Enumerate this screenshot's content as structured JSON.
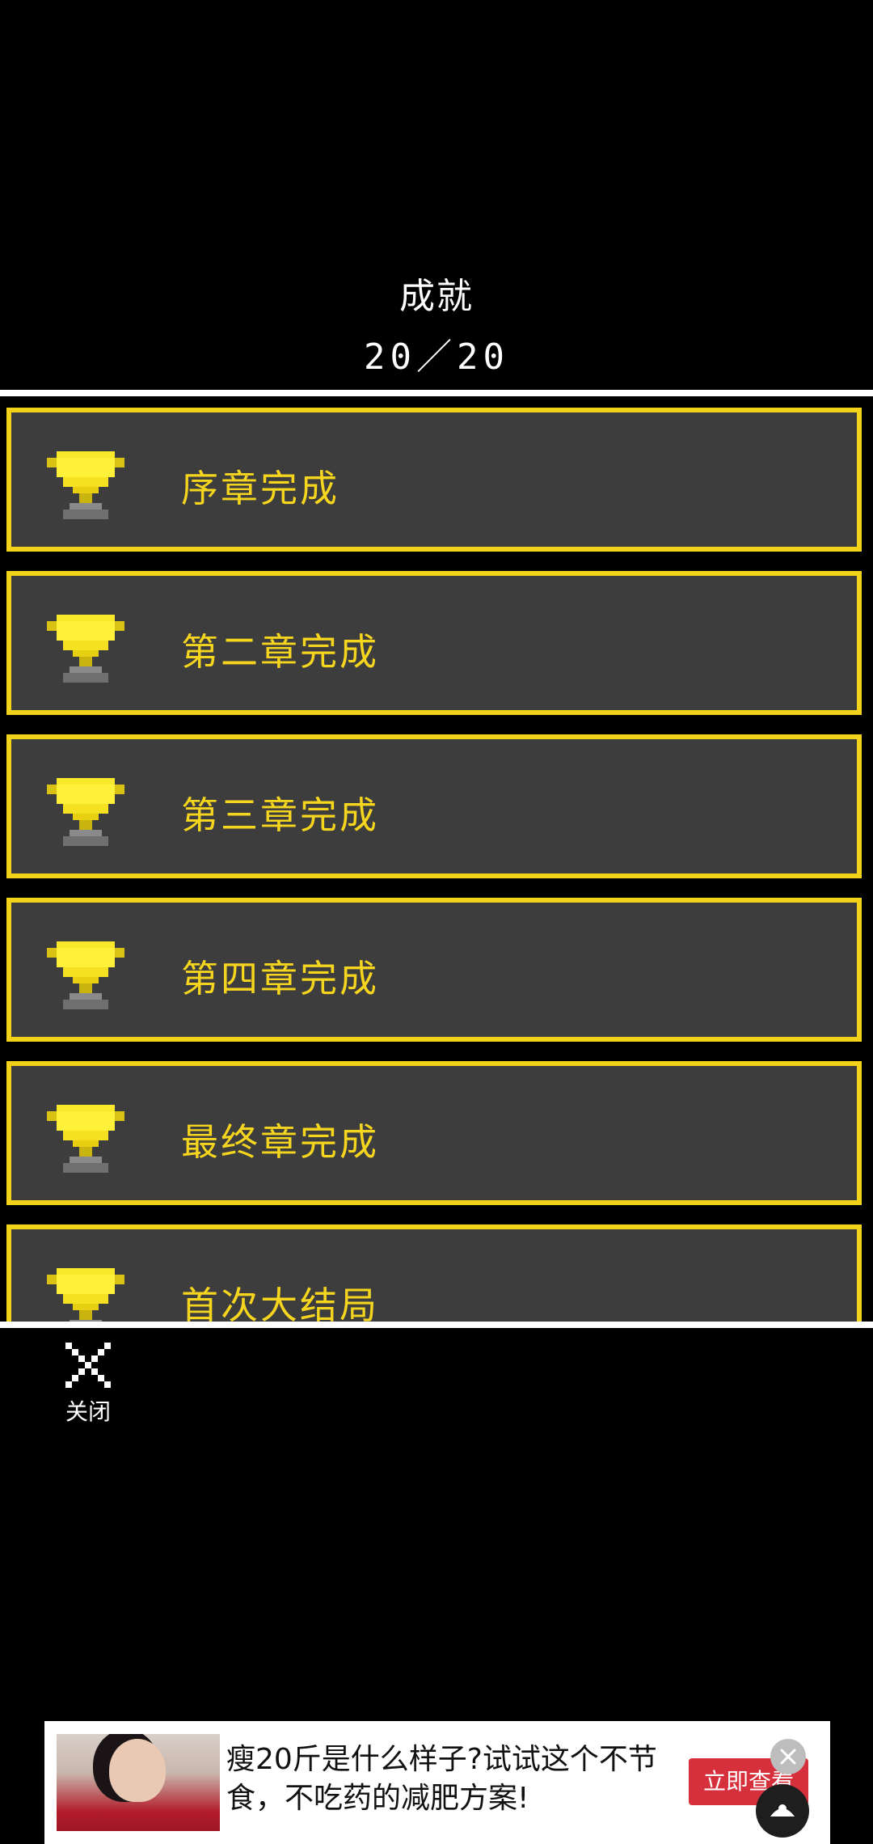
{
  "header": {
    "title": "成就",
    "count": "20／20"
  },
  "achievements": [
    {
      "label": "序章完成",
      "icon": "trophy-icon"
    },
    {
      "label": "第二章完成",
      "icon": "trophy-icon"
    },
    {
      "label": "第三章完成",
      "icon": "trophy-icon"
    },
    {
      "label": "第四章完成",
      "icon": "trophy-icon"
    },
    {
      "label": "最终章完成",
      "icon": "trophy-icon"
    },
    {
      "label": "首次大结局",
      "icon": "trophy-icon"
    }
  ],
  "footer": {
    "close_label": "关闭"
  },
  "ad": {
    "text": "瘦20斤是什么样子?试试这个不节食，不吃药的减肥方案!",
    "cta": "立即查看"
  },
  "colors": {
    "background": "#000000",
    "card_bg": "#3d3d3d",
    "accent_gold": "#f2d21b",
    "text_white": "#ffffff"
  }
}
